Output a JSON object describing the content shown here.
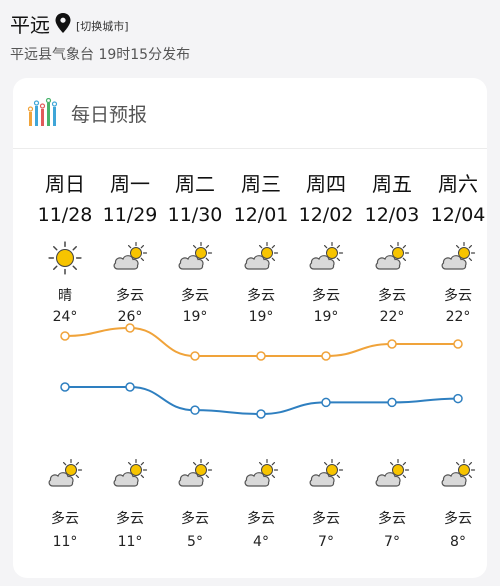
{
  "header": {
    "city": "平远",
    "switch_label": "[切换城市]",
    "subtitle": "平远县气象台 19时15分发布"
  },
  "card": {
    "title": "每日预报"
  },
  "days": [
    {
      "dow": "周日",
      "date": "11/28",
      "day_cond": "晴",
      "day_icon": "sun-icon",
      "high": "24°",
      "high_val": 24,
      "night_cond": "多云",
      "night_icon": "partly-cloudy-icon",
      "low": "11°",
      "low_val": 11
    },
    {
      "dow": "周一",
      "date": "11/29",
      "day_cond": "多云",
      "day_icon": "partly-cloudy-icon",
      "high": "26°",
      "high_val": 26,
      "night_cond": "多云",
      "night_icon": "partly-cloudy-icon",
      "low": "11°",
      "low_val": 11
    },
    {
      "dow": "周二",
      "date": "11/30",
      "day_cond": "多云",
      "day_icon": "partly-cloudy-icon",
      "high": "19°",
      "high_val": 19,
      "night_cond": "多云",
      "night_icon": "partly-cloudy-icon",
      "low": "5°",
      "low_val": 5
    },
    {
      "dow": "周三",
      "date": "12/01",
      "day_cond": "多云",
      "day_icon": "partly-cloudy-icon",
      "high": "19°",
      "high_val": 19,
      "night_cond": "多云",
      "night_icon": "partly-cloudy-icon",
      "low": "4°",
      "low_val": 4
    },
    {
      "dow": "周四",
      "date": "12/02",
      "day_cond": "多云",
      "day_icon": "partly-cloudy-icon",
      "high": "19°",
      "high_val": 19,
      "night_cond": "多云",
      "night_icon": "partly-cloudy-icon",
      "low": "7°",
      "low_val": 7
    },
    {
      "dow": "周五",
      "date": "12/03",
      "day_cond": "多云",
      "day_icon": "partly-cloudy-icon",
      "high": "22°",
      "high_val": 22,
      "night_cond": "多云",
      "night_icon": "partly-cloudy-icon",
      "low": "7°",
      "low_val": 7
    },
    {
      "dow": "周六",
      "date": "12/04",
      "day_cond": "多云",
      "day_icon": "partly-cloudy-icon",
      "high": "22°",
      "high_val": 22,
      "night_cond": "多云",
      "night_icon": "partly-cloudy-icon",
      "low": "8°",
      "low_val": 8
    }
  ],
  "colors": {
    "high_line": "#f0a33a",
    "low_line": "#2e7fc0",
    "sun": "#f7c400",
    "cloud": "#7d7d7d"
  }
}
